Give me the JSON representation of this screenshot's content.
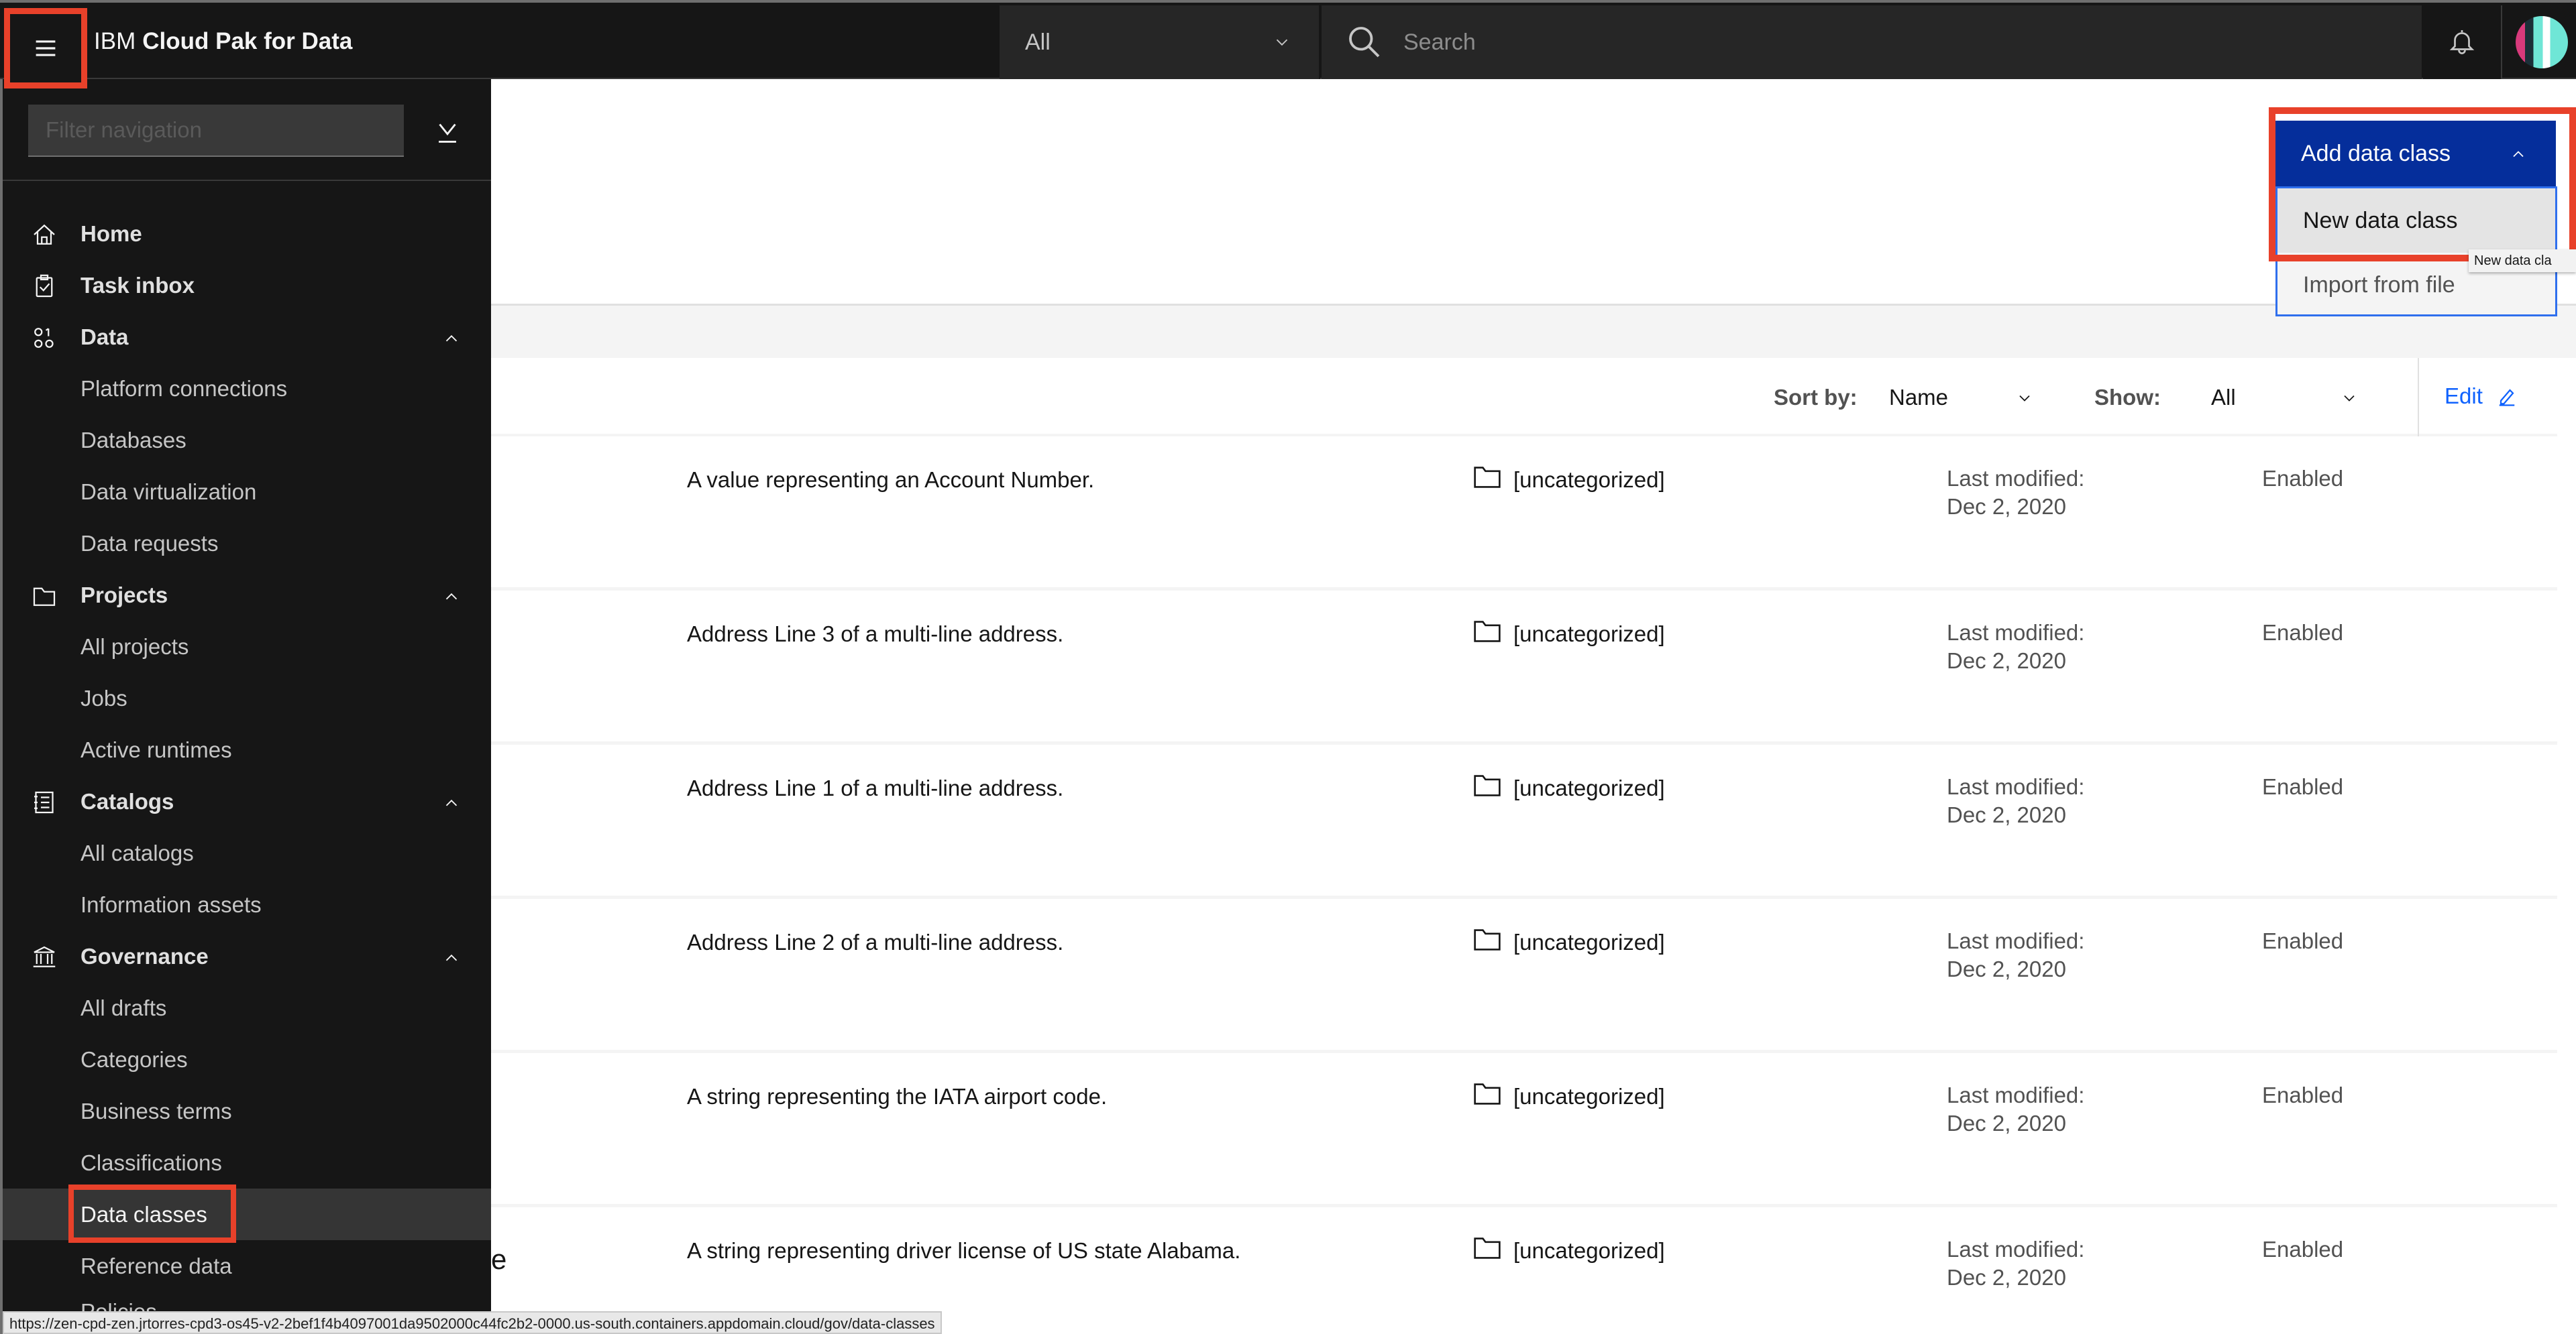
{
  "header": {
    "brand_prefix": "IBM",
    "brand_name": "Cloud Pak for Data",
    "scope_value": "All",
    "search_placeholder": "Search"
  },
  "sidebar": {
    "filter_placeholder": "Filter navigation",
    "items": [
      {
        "label": "Home",
        "icon": "home-icon",
        "type": "top"
      },
      {
        "label": "Task inbox",
        "icon": "task-icon",
        "type": "top"
      },
      {
        "label": "Data",
        "icon": "data-icon",
        "type": "section"
      },
      {
        "label": "Platform connections",
        "type": "sub"
      },
      {
        "label": "Databases",
        "type": "sub"
      },
      {
        "label": "Data virtualization",
        "type": "sub"
      },
      {
        "label": "Data requests",
        "type": "sub"
      },
      {
        "label": "Projects",
        "icon": "folder-icon",
        "type": "section"
      },
      {
        "label": "All projects",
        "type": "sub"
      },
      {
        "label": "Jobs",
        "type": "sub"
      },
      {
        "label": "Active runtimes",
        "type": "sub"
      },
      {
        "label": "Catalogs",
        "icon": "catalog-icon",
        "type": "section"
      },
      {
        "label": "All catalogs",
        "type": "sub"
      },
      {
        "label": "Information assets",
        "type": "sub"
      },
      {
        "label": "Governance",
        "icon": "governance-icon",
        "type": "section"
      },
      {
        "label": "All drafts",
        "type": "sub"
      },
      {
        "label": "Categories",
        "type": "sub"
      },
      {
        "label": "Business terms",
        "type": "sub"
      },
      {
        "label": "Classifications",
        "type": "sub"
      },
      {
        "label": "Data classes",
        "type": "sub",
        "active": true
      },
      {
        "label": "Reference data",
        "type": "sub"
      }
    ],
    "cut_item": "Policies"
  },
  "toolbar": {
    "sort_label": "Sort by:",
    "sort_value": "Name",
    "show_label": "Show:",
    "show_value": "All",
    "edit_label": "Edit"
  },
  "add_menu": {
    "button_label": "Add data class",
    "items": [
      "New data class",
      "Import from file"
    ],
    "tooltip": "New data cla"
  },
  "rows": [
    {
      "name_cut": "",
      "description": "A value representing an Account Number.",
      "category": "[uncategorized]",
      "modified_label": "Last modified:",
      "modified_date": "Dec 2, 2020",
      "status": "Enabled"
    },
    {
      "name_cut": "",
      "description": "Address Line 3 of a multi-line address.",
      "category": "[uncategorized]",
      "modified_label": "Last modified:",
      "modified_date": "Dec 2, 2020",
      "status": "Enabled"
    },
    {
      "name_cut": "",
      "description": "Address Line 1 of a multi-line address.",
      "category": "[uncategorized]",
      "modified_label": "Last modified:",
      "modified_date": "Dec 2, 2020",
      "status": "Enabled"
    },
    {
      "name_cut": "",
      "description": "Address Line 2 of a multi-line address.",
      "category": "[uncategorized]",
      "modified_label": "Last modified:",
      "modified_date": "Dec 2, 2020",
      "status": "Enabled"
    },
    {
      "name_cut": "",
      "description": "A string representing the IATA airport code.",
      "category": "[uncategorized]",
      "modified_label": "Last modified:",
      "modified_date": "Dec 2, 2020",
      "status": "Enabled"
    },
    {
      "name_cut": "e",
      "description": "A string representing driver license of US state Alabama.",
      "category": "[uncategorized]",
      "modified_label": "Last modified:",
      "modified_date": "Dec 2, 2020",
      "status": "Enabled"
    }
  ],
  "status_url": "https://zen-cpd-zen.jrtorres-cpd3-os45-v2-2bef1f4b4097001da9502000c44fc2b2-0000.us-south.containers.appdomain.cloud/gov/data-classes",
  "colors": {
    "header_bg": "#161616",
    "primary_button": "#052e9b",
    "link": "#0f62fe",
    "highlight_box": "#e8412a"
  }
}
